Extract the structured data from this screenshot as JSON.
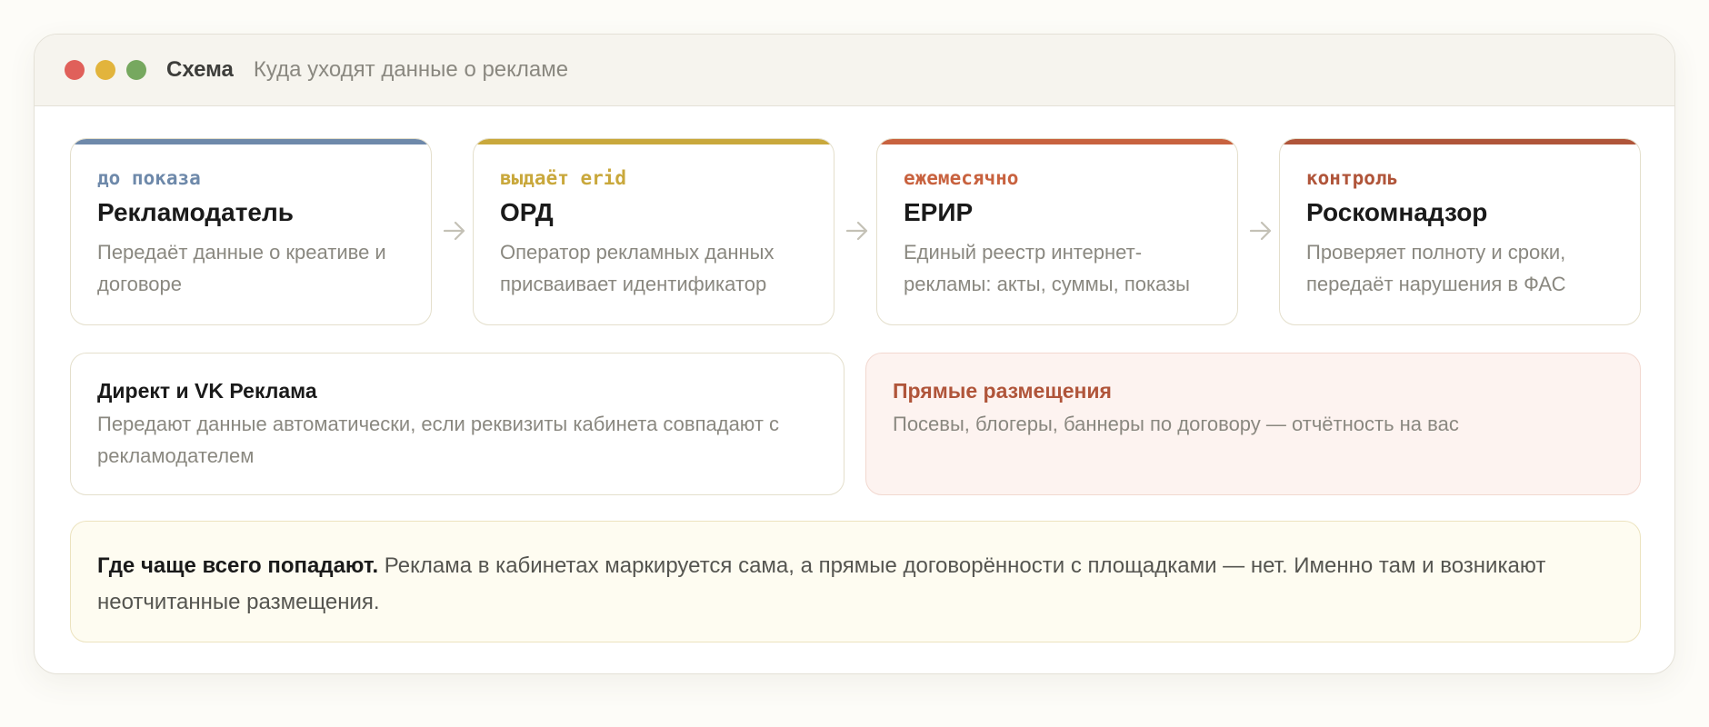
{
  "window": {
    "title": "Схема",
    "subtitle": "Куда уходят данные о рекламе"
  },
  "flow": {
    "arrow_icon": "arrow-right-icon",
    "stages": [
      {
        "tag": "до показа",
        "title": "Рекламодатель",
        "description": "Передаёт данные о креативе и договоре",
        "color": "#6e89aa"
      },
      {
        "tag": "выдаёт erid",
        "title": "ОРД",
        "description": "Оператор рекламных данных присваивает идентификатор",
        "color": "#c9a83c"
      },
      {
        "tag": "ежемесячно",
        "title": "ЕРИР",
        "description": "Единый реестр интернет-рекламы: акты, суммы, показы",
        "color": "#c8623f"
      },
      {
        "tag": "контроль",
        "title": "Роскомнадзор",
        "description": "Проверяет полноту и сроки, передаёт нарушения в ФАС",
        "color": "#b0553a"
      }
    ]
  },
  "platforms": [
    {
      "title": "Директ и VK Реклама",
      "description": "Передают данные автоматически, если реквизиты кабинета совпадают с рекламодателем"
    },
    {
      "title": "Прямые размещения",
      "description": "Посевы, блогеры, баннеры по договору — отчётность на вас",
      "accent": "#b0553a"
    }
  ],
  "note": {
    "lead": "Где чаще всего попадают.",
    "text": " Реклама в кабинетах маркируется сама, а прямые договорённости с площадками — нет. Именно там и возникают неотчитанные размещения."
  }
}
